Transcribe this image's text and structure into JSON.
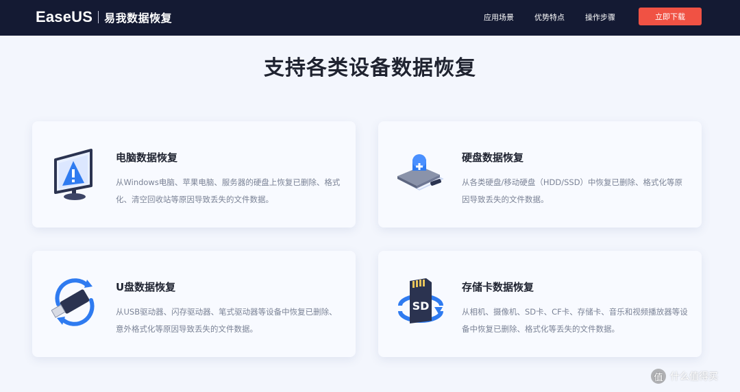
{
  "header": {
    "brand": "EaseUS",
    "brand_cn": "易我数据恢复",
    "nav": [
      "应用场景",
      "优势特点",
      "操作步骤"
    ],
    "cta_label": "立即下载"
  },
  "main": {
    "title": "支持各类设备数据恢复",
    "cards": [
      {
        "title": "电脑数据恢复",
        "desc": "从Windows电脑、苹果电脑、服务器的硬盘上恢复已删除、格式化、清空回收站等原因导致丢失的文件数据。",
        "icon": "computer-warning-icon"
      },
      {
        "title": "硬盘数据恢复",
        "desc": "从各类硬盘/移动硬盘（HDD/SSD）中恢复已删除、格式化等原因导致丢失的文件数据。",
        "icon": "hard-drive-icon"
      },
      {
        "title": "U盘数据恢复",
        "desc": "从USB驱动器、闪存驱动器、笔式驱动器等设备中恢复已删除、意外格式化等原因导致丢失的文件数据。",
        "icon": "usb-drive-icon"
      },
      {
        "title": "存储卡数据恢复",
        "desc": "从相机、摄像机、SD卡、CF卡、存储卡、音乐和视频播放器等设备中恢复已删除、格式化等丢失的文件数据。",
        "icon": "sd-card-icon"
      }
    ]
  },
  "watermark": {
    "symbol": "值",
    "text": "什么值得买"
  },
  "colors": {
    "header_bg": "#141a33",
    "cta": "#f05244",
    "accent": "#2f7bf0",
    "page_bg": "#f3f6fd"
  }
}
